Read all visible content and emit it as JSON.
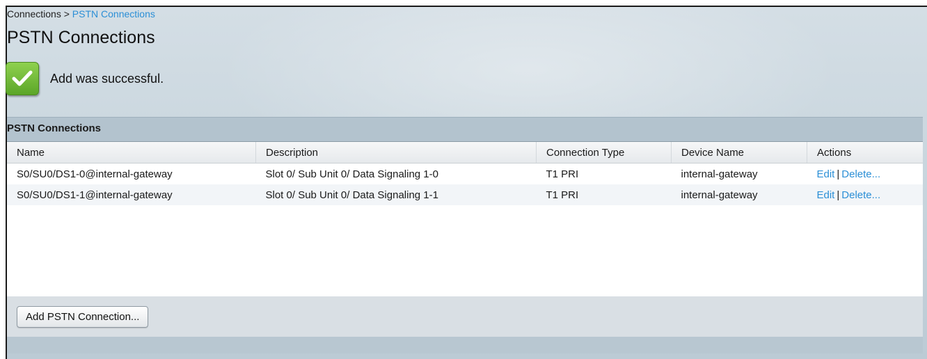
{
  "breadcrumb": {
    "parent": "Connections",
    "separator": ">",
    "current": "PSTN Connections"
  },
  "page_title": "PSTN Connections",
  "alert": {
    "icon": "checkmark-icon",
    "message": "Add was successful."
  },
  "panel": {
    "title": "PSTN Connections",
    "columns": {
      "name": "Name",
      "description": "Description",
      "connection_type": "Connection Type",
      "device_name": "Device Name",
      "actions": "Actions"
    },
    "rows": [
      {
        "name": "S0/SU0/DS1-0@internal-gateway",
        "description": "Slot 0/ Sub Unit 0/ Data Signaling 1-0",
        "connection_type": "T1 PRI",
        "device_name": "internal-gateway",
        "edit": "Edit",
        "separator": "|",
        "delete": "Delete..."
      },
      {
        "name": "S0/SU0/DS1-1@internal-gateway",
        "description": "Slot 0/ Sub Unit 0/ Data Signaling 1-1",
        "connection_type": "T1 PRI",
        "device_name": "internal-gateway",
        "edit": "Edit",
        "separator": "|",
        "delete": "Delete..."
      }
    ],
    "add_button": "Add PSTN Connection..."
  },
  "colors": {
    "link": "#2b8fd6",
    "success_green": "#6bb734",
    "panel_bg": "#b3c3ce"
  }
}
